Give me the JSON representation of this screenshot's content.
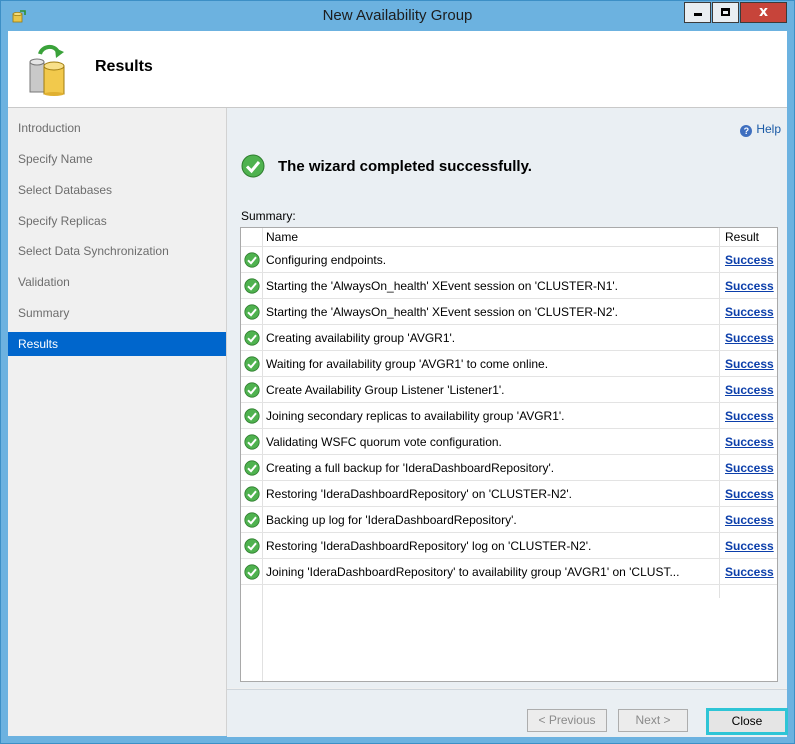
{
  "window": {
    "title": "New Availability Group",
    "close_glyph": "x"
  },
  "header": {
    "title": "Results",
    "icon": "database-wizard-icon"
  },
  "nav": {
    "items": [
      {
        "label": "Introduction",
        "active": false
      },
      {
        "label": "Specify Name",
        "active": false
      },
      {
        "label": "Select Databases",
        "active": false
      },
      {
        "label": "Specify Replicas",
        "active": false
      },
      {
        "label": "Select Data Synchronization",
        "active": false
      },
      {
        "label": "Validation",
        "active": false
      },
      {
        "label": "Summary",
        "active": false
      },
      {
        "label": "Results",
        "active": true
      }
    ]
  },
  "main": {
    "help_label": "Help",
    "banner": "The wizard completed successfully.",
    "summary_label": "Summary:",
    "columns": {
      "name": "Name",
      "result": "Result"
    },
    "rows": [
      {
        "name": "Configuring endpoints.",
        "result": "Success"
      },
      {
        "name": "Starting the 'AlwaysOn_health' XEvent session on 'CLUSTER-N1'.",
        "result": "Success"
      },
      {
        "name": "Starting the 'AlwaysOn_health' XEvent session on 'CLUSTER-N2'.",
        "result": "Success"
      },
      {
        "name": "Creating availability group 'AVGR1'.",
        "result": "Success"
      },
      {
        "name": "Waiting for availability group 'AVGR1' to come online.",
        "result": "Success"
      },
      {
        "name": "Create Availability Group Listener 'Listener1'.",
        "result": "Success"
      },
      {
        "name": "Joining secondary replicas to availability group 'AVGR1'.",
        "result": "Success"
      },
      {
        "name": "Validating WSFC quorum vote configuration.",
        "result": "Success"
      },
      {
        "name": "Creating a full backup for 'IderaDashboardRepository'.",
        "result": "Success"
      },
      {
        "name": "Restoring 'IderaDashboardRepository' on 'CLUSTER-N2'.",
        "result": "Success"
      },
      {
        "name": "Backing up log for 'IderaDashboardRepository'.",
        "result": "Success"
      },
      {
        "name": "Restoring 'IderaDashboardRepository' log on 'CLUSTER-N2'.",
        "result": "Success"
      },
      {
        "name": "Joining 'IderaDashboardRepository' to availability group 'AVGR1' on 'CLUST...",
        "result": "Success"
      }
    ]
  },
  "footer": {
    "previous_label": "< Previous",
    "next_label": "Next >",
    "close_label": "Close"
  },
  "colors": {
    "titlebar": "#6cb2e0",
    "nav_active": "#0066cc",
    "link": "#0b3eaa",
    "close_highlight": "#2ec5d6",
    "success_green": "#3aa23a"
  }
}
